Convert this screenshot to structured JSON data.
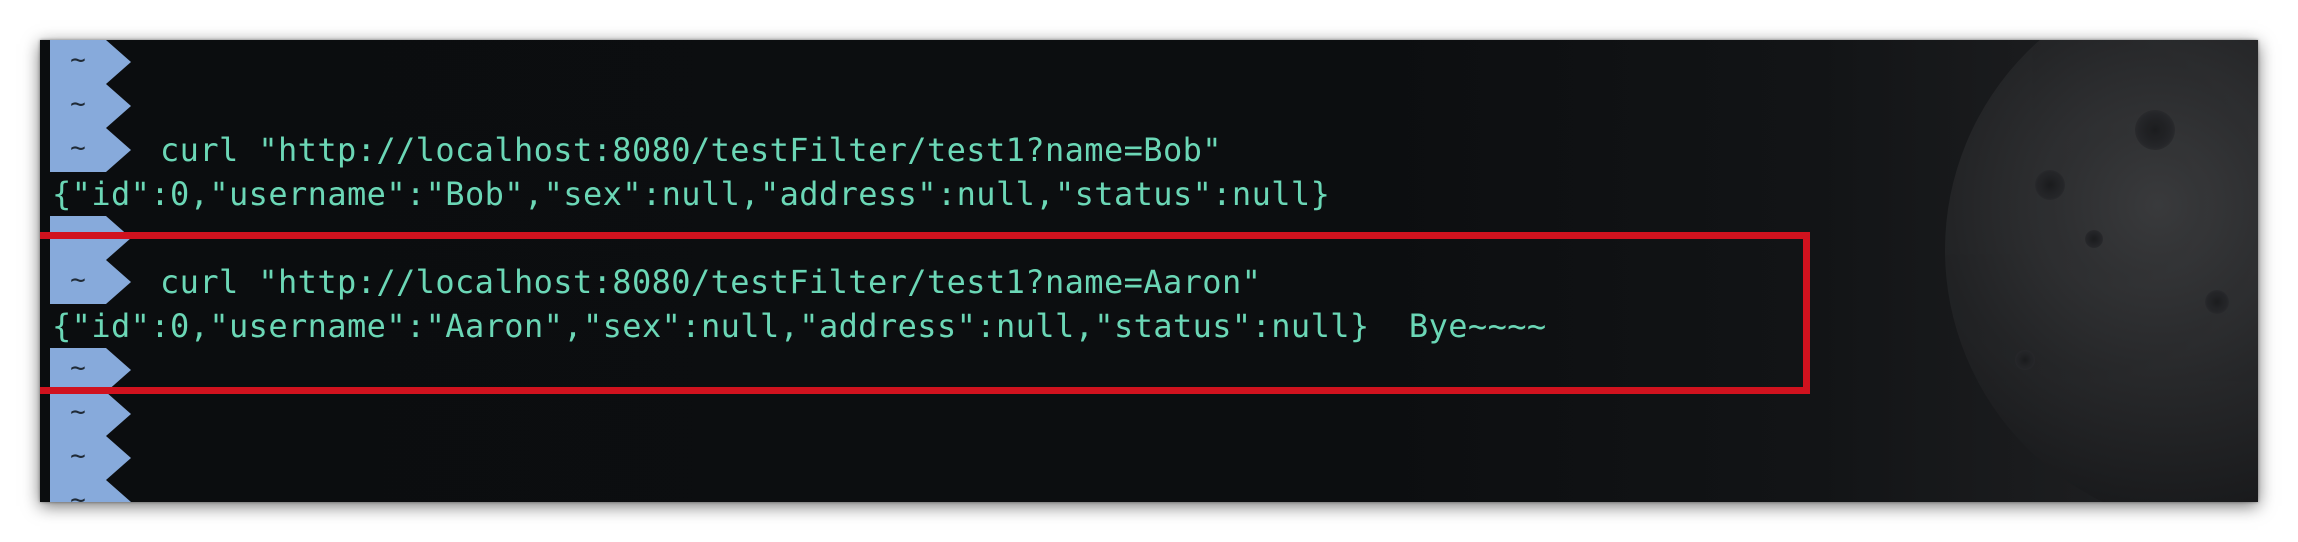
{
  "terminal": {
    "prompt_symbol": "~",
    "lines": [
      {
        "type": "prompt",
        "command": ""
      },
      {
        "type": "prompt",
        "command": ""
      },
      {
        "type": "prompt",
        "command": "curl \"http://localhost:8080/testFilter/test1?name=Bob\""
      },
      {
        "type": "output",
        "text": "{\"id\":0,\"username\":\"Bob\",\"sex\":null,\"address\":null,\"status\":null}"
      },
      {
        "type": "prompt",
        "command": ""
      },
      {
        "type": "prompt",
        "command": "curl \"http://localhost:8080/testFilter/test1?name=Aaron\""
      },
      {
        "type": "output",
        "text": "{\"id\":0,\"username\":\"Aaron\",\"sex\":null,\"address\":null,\"status\":null}  Bye~~~~"
      },
      {
        "type": "prompt",
        "command": ""
      },
      {
        "type": "prompt",
        "command": ""
      },
      {
        "type": "prompt",
        "command": ""
      },
      {
        "type": "prompt",
        "command": ""
      }
    ]
  },
  "colors": {
    "prompt_bg": "#87aadb",
    "text": "#6bd7b6",
    "highlight": "#d0121e"
  }
}
